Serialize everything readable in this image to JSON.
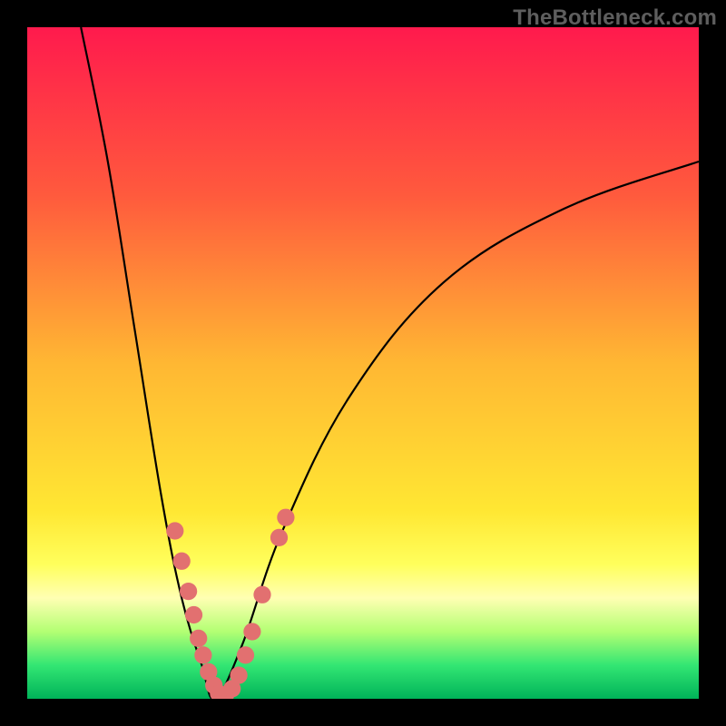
{
  "watermark": "TheBottleneck.com",
  "chart_data": {
    "type": "line",
    "title": "",
    "xlabel": "",
    "ylabel": "",
    "xlim": [
      0,
      100
    ],
    "ylim": [
      0,
      100
    ],
    "curve": {
      "left_branch": [
        {
          "x": 8,
          "y": 100
        },
        {
          "x": 12,
          "y": 80
        },
        {
          "x": 16,
          "y": 55
        },
        {
          "x": 20,
          "y": 30
        },
        {
          "x": 23,
          "y": 15
        },
        {
          "x": 26,
          "y": 5
        },
        {
          "x": 28,
          "y": 0
        }
      ],
      "right_branch": [
        {
          "x": 28,
          "y": 0
        },
        {
          "x": 32,
          "y": 8
        },
        {
          "x": 38,
          "y": 25
        },
        {
          "x": 48,
          "y": 45
        },
        {
          "x": 62,
          "y": 62
        },
        {
          "x": 80,
          "y": 73
        },
        {
          "x": 100,
          "y": 80
        }
      ]
    },
    "markers": {
      "color": "#e27070",
      "radius_pct": 1.3,
      "points": [
        {
          "x": 22.0,
          "y": 25.0
        },
        {
          "x": 23.0,
          "y": 20.5
        },
        {
          "x": 24.0,
          "y": 16.0
        },
        {
          "x": 24.8,
          "y": 12.5
        },
        {
          "x": 25.5,
          "y": 9.0
        },
        {
          "x": 26.2,
          "y": 6.5
        },
        {
          "x": 27.0,
          "y": 4.0
        },
        {
          "x": 27.8,
          "y": 2.0
        },
        {
          "x": 28.5,
          "y": 0.8
        },
        {
          "x": 29.5,
          "y": 0.5
        },
        {
          "x": 30.5,
          "y": 1.5
        },
        {
          "x": 31.5,
          "y": 3.5
        },
        {
          "x": 32.5,
          "y": 6.5
        },
        {
          "x": 33.5,
          "y": 10.0
        },
        {
          "x": 35.0,
          "y": 15.5
        },
        {
          "x": 37.5,
          "y": 24.0
        },
        {
          "x": 38.5,
          "y": 27.0
        }
      ]
    }
  }
}
